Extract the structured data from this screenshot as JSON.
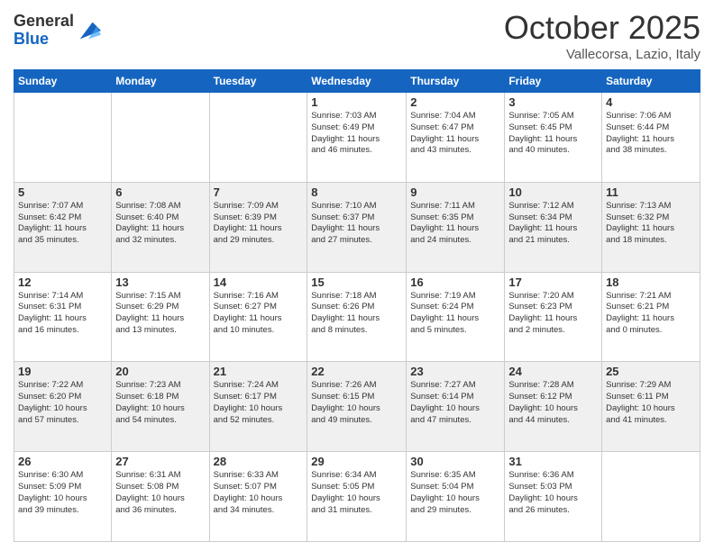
{
  "logo": {
    "general": "General",
    "blue": "Blue"
  },
  "header": {
    "month": "October 2025",
    "location": "Vallecorsa, Lazio, Italy"
  },
  "weekdays": [
    "Sunday",
    "Monday",
    "Tuesday",
    "Wednesday",
    "Thursday",
    "Friday",
    "Saturday"
  ],
  "weeks": [
    [
      {
        "day": "",
        "info": ""
      },
      {
        "day": "",
        "info": ""
      },
      {
        "day": "",
        "info": ""
      },
      {
        "day": "1",
        "info": "Sunrise: 7:03 AM\nSunset: 6:49 PM\nDaylight: 11 hours\nand 46 minutes."
      },
      {
        "day": "2",
        "info": "Sunrise: 7:04 AM\nSunset: 6:47 PM\nDaylight: 11 hours\nand 43 minutes."
      },
      {
        "day": "3",
        "info": "Sunrise: 7:05 AM\nSunset: 6:45 PM\nDaylight: 11 hours\nand 40 minutes."
      },
      {
        "day": "4",
        "info": "Sunrise: 7:06 AM\nSunset: 6:44 PM\nDaylight: 11 hours\nand 38 minutes."
      }
    ],
    [
      {
        "day": "5",
        "info": "Sunrise: 7:07 AM\nSunset: 6:42 PM\nDaylight: 11 hours\nand 35 minutes."
      },
      {
        "day": "6",
        "info": "Sunrise: 7:08 AM\nSunset: 6:40 PM\nDaylight: 11 hours\nand 32 minutes."
      },
      {
        "day": "7",
        "info": "Sunrise: 7:09 AM\nSunset: 6:39 PM\nDaylight: 11 hours\nand 29 minutes."
      },
      {
        "day": "8",
        "info": "Sunrise: 7:10 AM\nSunset: 6:37 PM\nDaylight: 11 hours\nand 27 minutes."
      },
      {
        "day": "9",
        "info": "Sunrise: 7:11 AM\nSunset: 6:35 PM\nDaylight: 11 hours\nand 24 minutes."
      },
      {
        "day": "10",
        "info": "Sunrise: 7:12 AM\nSunset: 6:34 PM\nDaylight: 11 hours\nand 21 minutes."
      },
      {
        "day": "11",
        "info": "Sunrise: 7:13 AM\nSunset: 6:32 PM\nDaylight: 11 hours\nand 18 minutes."
      }
    ],
    [
      {
        "day": "12",
        "info": "Sunrise: 7:14 AM\nSunset: 6:31 PM\nDaylight: 11 hours\nand 16 minutes."
      },
      {
        "day": "13",
        "info": "Sunrise: 7:15 AM\nSunset: 6:29 PM\nDaylight: 11 hours\nand 13 minutes."
      },
      {
        "day": "14",
        "info": "Sunrise: 7:16 AM\nSunset: 6:27 PM\nDaylight: 11 hours\nand 10 minutes."
      },
      {
        "day": "15",
        "info": "Sunrise: 7:18 AM\nSunset: 6:26 PM\nDaylight: 11 hours\nand 8 minutes."
      },
      {
        "day": "16",
        "info": "Sunrise: 7:19 AM\nSunset: 6:24 PM\nDaylight: 11 hours\nand 5 minutes."
      },
      {
        "day": "17",
        "info": "Sunrise: 7:20 AM\nSunset: 6:23 PM\nDaylight: 11 hours\nand 2 minutes."
      },
      {
        "day": "18",
        "info": "Sunrise: 7:21 AM\nSunset: 6:21 PM\nDaylight: 11 hours\nand 0 minutes."
      }
    ],
    [
      {
        "day": "19",
        "info": "Sunrise: 7:22 AM\nSunset: 6:20 PM\nDaylight: 10 hours\nand 57 minutes."
      },
      {
        "day": "20",
        "info": "Sunrise: 7:23 AM\nSunset: 6:18 PM\nDaylight: 10 hours\nand 54 minutes."
      },
      {
        "day": "21",
        "info": "Sunrise: 7:24 AM\nSunset: 6:17 PM\nDaylight: 10 hours\nand 52 minutes."
      },
      {
        "day": "22",
        "info": "Sunrise: 7:26 AM\nSunset: 6:15 PM\nDaylight: 10 hours\nand 49 minutes."
      },
      {
        "day": "23",
        "info": "Sunrise: 7:27 AM\nSunset: 6:14 PM\nDaylight: 10 hours\nand 47 minutes."
      },
      {
        "day": "24",
        "info": "Sunrise: 7:28 AM\nSunset: 6:12 PM\nDaylight: 10 hours\nand 44 minutes."
      },
      {
        "day": "25",
        "info": "Sunrise: 7:29 AM\nSunset: 6:11 PM\nDaylight: 10 hours\nand 41 minutes."
      }
    ],
    [
      {
        "day": "26",
        "info": "Sunrise: 6:30 AM\nSunset: 5:09 PM\nDaylight: 10 hours\nand 39 minutes."
      },
      {
        "day": "27",
        "info": "Sunrise: 6:31 AM\nSunset: 5:08 PM\nDaylight: 10 hours\nand 36 minutes."
      },
      {
        "day": "28",
        "info": "Sunrise: 6:33 AM\nSunset: 5:07 PM\nDaylight: 10 hours\nand 34 minutes."
      },
      {
        "day": "29",
        "info": "Sunrise: 6:34 AM\nSunset: 5:05 PM\nDaylight: 10 hours\nand 31 minutes."
      },
      {
        "day": "30",
        "info": "Sunrise: 6:35 AM\nSunset: 5:04 PM\nDaylight: 10 hours\nand 29 minutes."
      },
      {
        "day": "31",
        "info": "Sunrise: 6:36 AM\nSunset: 5:03 PM\nDaylight: 10 hours\nand 26 minutes."
      },
      {
        "day": "",
        "info": ""
      }
    ]
  ]
}
